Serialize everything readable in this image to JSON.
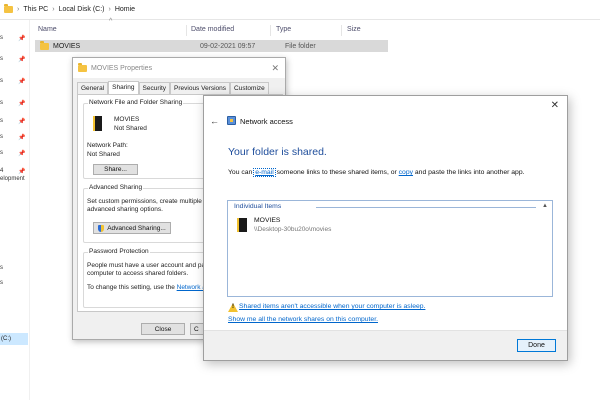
{
  "explorer": {
    "breadcrumbs": [
      "This PC",
      "Local Disk (C:)",
      "Homie"
    ],
    "sidebar_labels": [
      "s",
      "s",
      "s",
      "s",
      "s",
      "s",
      "s",
      "4",
      "elopment",
      "s",
      "s"
    ],
    "sidebar_selected": "(C:)",
    "columns": [
      "Name",
      "Date modified",
      "Type",
      "Size"
    ],
    "row": {
      "name": "MOVIES",
      "date": "09-02-2021 09:57",
      "type": "File folder"
    }
  },
  "props": {
    "title": "MOVIES Properties",
    "tabs": [
      "General",
      "Sharing",
      "Security",
      "Previous Versions",
      "Customize"
    ],
    "nffs_title": "Network File and Folder Sharing",
    "folder_name": "MOVIES",
    "folder_status": "Not Shared",
    "path_label": "Network Path:",
    "path_value": "Not Shared",
    "share_btn": "Share...",
    "adv_title": "Advanced Sharing",
    "adv_desc1": "Set custom permissions, create multiple sh",
    "adv_desc2": "advanced sharing options.",
    "adv_btn": "Advanced Sharing...",
    "pp_title": "Password Protection",
    "pp_desc1": "People must have a user account and pa",
    "pp_desc2": "computer to access shared folders.",
    "pp_change": "To change this setting, use the",
    "pp_link": "Network a",
    "close_btn": "Close",
    "cancel_btn_partial": "C"
  },
  "net": {
    "title": "Network access",
    "heading": "Your folder is shared.",
    "desc_pre": "You can ",
    "desc_email": "e-mail",
    "desc_mid": " someone links to these shared items, or ",
    "desc_copy": "copy",
    "desc_post": " and paste the links into another app.",
    "items_header": "Individual Items",
    "item_name": "MOVIES",
    "item_path": "\\\\Desktop-30bu20o\\movies",
    "warn_link": "Shared items aren't accessible when your computer is asleep.",
    "shares_link": "Show me all the network shares on this computer.",
    "done_btn": "Done"
  }
}
